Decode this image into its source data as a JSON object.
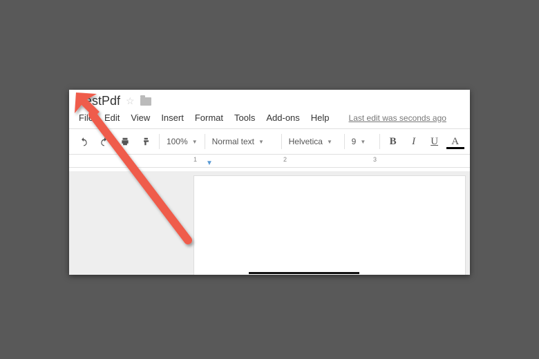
{
  "doc": {
    "title": "TestPdf"
  },
  "menu": {
    "file": "File",
    "edit": "Edit",
    "view": "View",
    "insert": "Insert",
    "format": "Format",
    "tools": "Tools",
    "addons": "Add-ons",
    "help": "Help",
    "last_edit": "Last edit was seconds ago"
  },
  "toolbar": {
    "zoom": "100%",
    "style": "Normal text",
    "font": "Helvetica",
    "font_size": "9",
    "bold": "B",
    "italic": "I",
    "underline": "U",
    "text_color": "A"
  },
  "ruler": {
    "ticks": [
      "1",
      "2",
      "3"
    ]
  }
}
